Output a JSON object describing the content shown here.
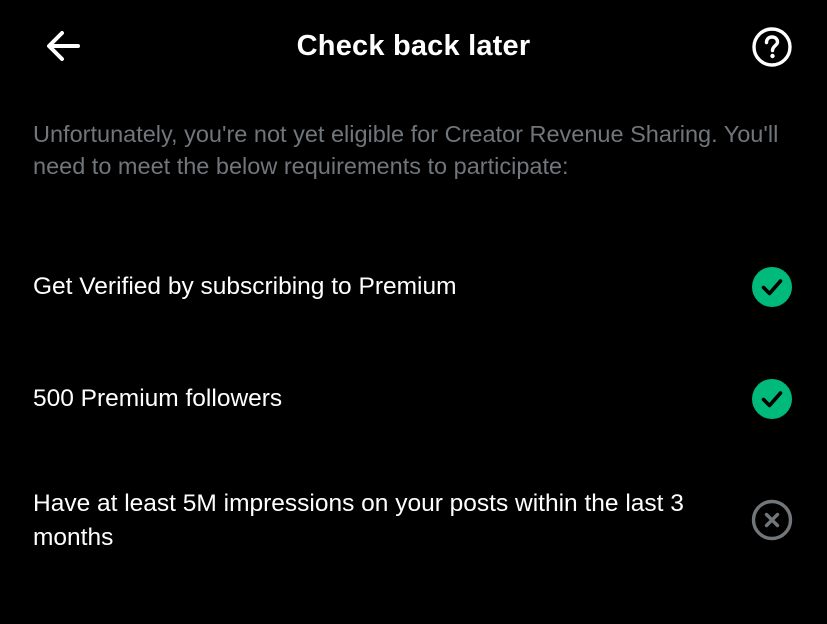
{
  "header": {
    "title": "Check back later"
  },
  "intro": {
    "text": "Unfortunately, you're not yet eligible for Creator Revenue Sharing. You'll need to meet the below requirements to participate:"
  },
  "requirements": [
    {
      "label": "Get Verified by subscribing to Premium",
      "status": "met",
      "icon": "check-circle-icon"
    },
    {
      "label": "500 Premium followers",
      "status": "met",
      "icon": "check-circle-icon"
    },
    {
      "label": "Have at least 5M impressions on your posts within the last 3 months",
      "status": "not-met",
      "icon": "x-circle-icon"
    }
  ],
  "icons": {
    "back": "back-arrow-icon",
    "help": "help-question-icon"
  },
  "colors": {
    "background": "#000000",
    "text": "#ffffff",
    "secondary_text": "#71767b",
    "success": "#00ba7c",
    "inactive": "#71767b"
  }
}
